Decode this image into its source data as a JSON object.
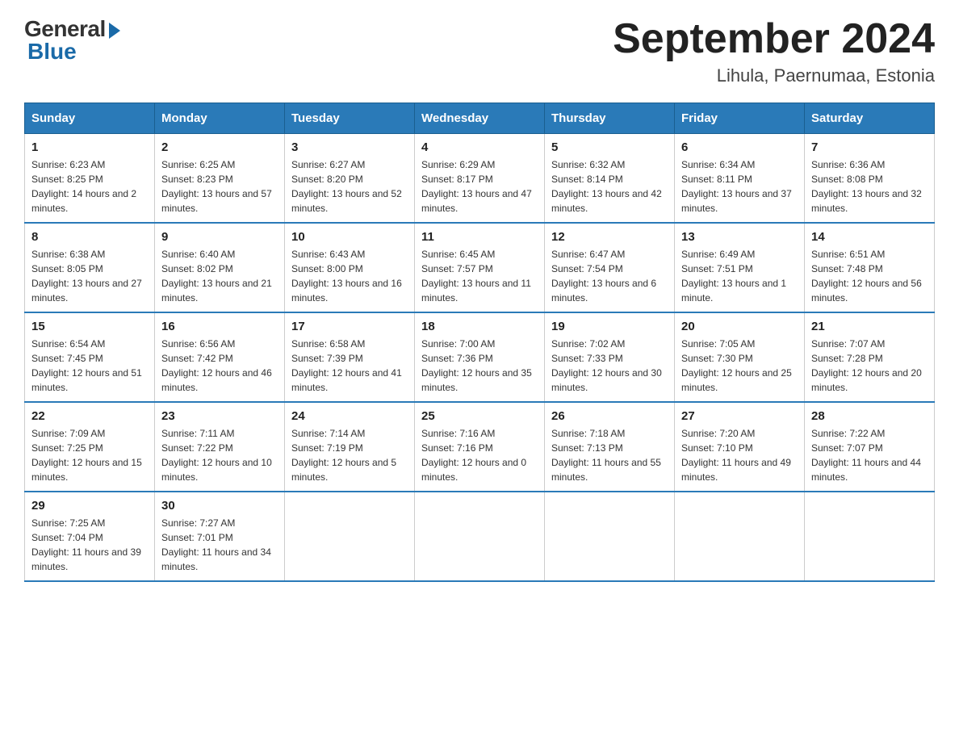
{
  "logo": {
    "general": "General",
    "blue": "Blue"
  },
  "title": "September 2024",
  "location": "Lihula, Paernumaa, Estonia",
  "days_of_week": [
    "Sunday",
    "Monday",
    "Tuesday",
    "Wednesday",
    "Thursday",
    "Friday",
    "Saturday"
  ],
  "weeks": [
    [
      {
        "day": "1",
        "sunrise": "6:23 AM",
        "sunset": "8:25 PM",
        "daylight": "14 hours and 2 minutes."
      },
      {
        "day": "2",
        "sunrise": "6:25 AM",
        "sunset": "8:23 PM",
        "daylight": "13 hours and 57 minutes."
      },
      {
        "day": "3",
        "sunrise": "6:27 AM",
        "sunset": "8:20 PM",
        "daylight": "13 hours and 52 minutes."
      },
      {
        "day": "4",
        "sunrise": "6:29 AM",
        "sunset": "8:17 PM",
        "daylight": "13 hours and 47 minutes."
      },
      {
        "day": "5",
        "sunrise": "6:32 AM",
        "sunset": "8:14 PM",
        "daylight": "13 hours and 42 minutes."
      },
      {
        "day": "6",
        "sunrise": "6:34 AM",
        "sunset": "8:11 PM",
        "daylight": "13 hours and 37 minutes."
      },
      {
        "day": "7",
        "sunrise": "6:36 AM",
        "sunset": "8:08 PM",
        "daylight": "13 hours and 32 minutes."
      }
    ],
    [
      {
        "day": "8",
        "sunrise": "6:38 AM",
        "sunset": "8:05 PM",
        "daylight": "13 hours and 27 minutes."
      },
      {
        "day": "9",
        "sunrise": "6:40 AM",
        "sunset": "8:02 PM",
        "daylight": "13 hours and 21 minutes."
      },
      {
        "day": "10",
        "sunrise": "6:43 AM",
        "sunset": "8:00 PM",
        "daylight": "13 hours and 16 minutes."
      },
      {
        "day": "11",
        "sunrise": "6:45 AM",
        "sunset": "7:57 PM",
        "daylight": "13 hours and 11 minutes."
      },
      {
        "day": "12",
        "sunrise": "6:47 AM",
        "sunset": "7:54 PM",
        "daylight": "13 hours and 6 minutes."
      },
      {
        "day": "13",
        "sunrise": "6:49 AM",
        "sunset": "7:51 PM",
        "daylight": "13 hours and 1 minute."
      },
      {
        "day": "14",
        "sunrise": "6:51 AM",
        "sunset": "7:48 PM",
        "daylight": "12 hours and 56 minutes."
      }
    ],
    [
      {
        "day": "15",
        "sunrise": "6:54 AM",
        "sunset": "7:45 PM",
        "daylight": "12 hours and 51 minutes."
      },
      {
        "day": "16",
        "sunrise": "6:56 AM",
        "sunset": "7:42 PM",
        "daylight": "12 hours and 46 minutes."
      },
      {
        "day": "17",
        "sunrise": "6:58 AM",
        "sunset": "7:39 PM",
        "daylight": "12 hours and 41 minutes."
      },
      {
        "day": "18",
        "sunrise": "7:00 AM",
        "sunset": "7:36 PM",
        "daylight": "12 hours and 35 minutes."
      },
      {
        "day": "19",
        "sunrise": "7:02 AM",
        "sunset": "7:33 PM",
        "daylight": "12 hours and 30 minutes."
      },
      {
        "day": "20",
        "sunrise": "7:05 AM",
        "sunset": "7:30 PM",
        "daylight": "12 hours and 25 minutes."
      },
      {
        "day": "21",
        "sunrise": "7:07 AM",
        "sunset": "7:28 PM",
        "daylight": "12 hours and 20 minutes."
      }
    ],
    [
      {
        "day": "22",
        "sunrise": "7:09 AM",
        "sunset": "7:25 PM",
        "daylight": "12 hours and 15 minutes."
      },
      {
        "day": "23",
        "sunrise": "7:11 AM",
        "sunset": "7:22 PM",
        "daylight": "12 hours and 10 minutes."
      },
      {
        "day": "24",
        "sunrise": "7:14 AM",
        "sunset": "7:19 PM",
        "daylight": "12 hours and 5 minutes."
      },
      {
        "day": "25",
        "sunrise": "7:16 AM",
        "sunset": "7:16 PM",
        "daylight": "12 hours and 0 minutes."
      },
      {
        "day": "26",
        "sunrise": "7:18 AM",
        "sunset": "7:13 PM",
        "daylight": "11 hours and 55 minutes."
      },
      {
        "day": "27",
        "sunrise": "7:20 AM",
        "sunset": "7:10 PM",
        "daylight": "11 hours and 49 minutes."
      },
      {
        "day": "28",
        "sunrise": "7:22 AM",
        "sunset": "7:07 PM",
        "daylight": "11 hours and 44 minutes."
      }
    ],
    [
      {
        "day": "29",
        "sunrise": "7:25 AM",
        "sunset": "7:04 PM",
        "daylight": "11 hours and 39 minutes."
      },
      {
        "day": "30",
        "sunrise": "7:27 AM",
        "sunset": "7:01 PM",
        "daylight": "11 hours and 34 minutes."
      },
      null,
      null,
      null,
      null,
      null
    ]
  ]
}
